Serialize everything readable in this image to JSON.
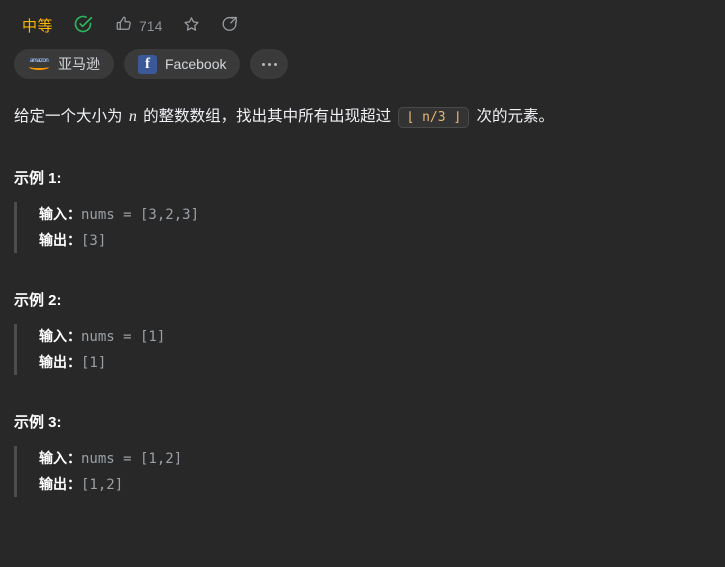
{
  "meta": {
    "difficulty": "中等",
    "solved_icon": "check-circle-icon",
    "like_icon": "thumbs-up-icon",
    "like_count": "714",
    "star_icon": "star-icon",
    "share_icon": "share-icon"
  },
  "tags": {
    "items": [
      {
        "label": "亚马逊",
        "icon": "amazon-logo-icon",
        "mark_text": "amazon"
      },
      {
        "label": "Facebook",
        "icon": "facebook-logo-icon",
        "mark_text": "f"
      }
    ],
    "more_label": "•••"
  },
  "problem": {
    "statement_prefix": "给定一个大小为 ",
    "var_n": "n",
    "statement_mid": " 的整数数组，找出其中所有出现超过 ",
    "inline_code": "⌊ n/3 ⌋",
    "statement_suffix": " 次的元素。"
  },
  "examples": [
    {
      "title": "示例 1:",
      "input_label": "输入：",
      "input_value": "nums = [3,2,3]",
      "output_label": "输出：",
      "output_value": "[3]"
    },
    {
      "title": "示例 2:",
      "input_label": "输入：",
      "input_value": "nums = [1]",
      "output_label": "输出：",
      "output_value": "[1]"
    },
    {
      "title": "示例 3:",
      "input_label": "输入：",
      "input_value": "nums = [1,2]",
      "output_label": "输出：",
      "output_value": "[1,2]"
    }
  ],
  "colors": {
    "background": "#282828",
    "difficulty": "#ffb800",
    "solved_green": "#2db55d",
    "text": "#eff1f6",
    "muted": "#9aa0a6",
    "code_accent": "#eab676",
    "facebook_blue": "#3b5998",
    "amazon_orange": "#ff9900"
  }
}
